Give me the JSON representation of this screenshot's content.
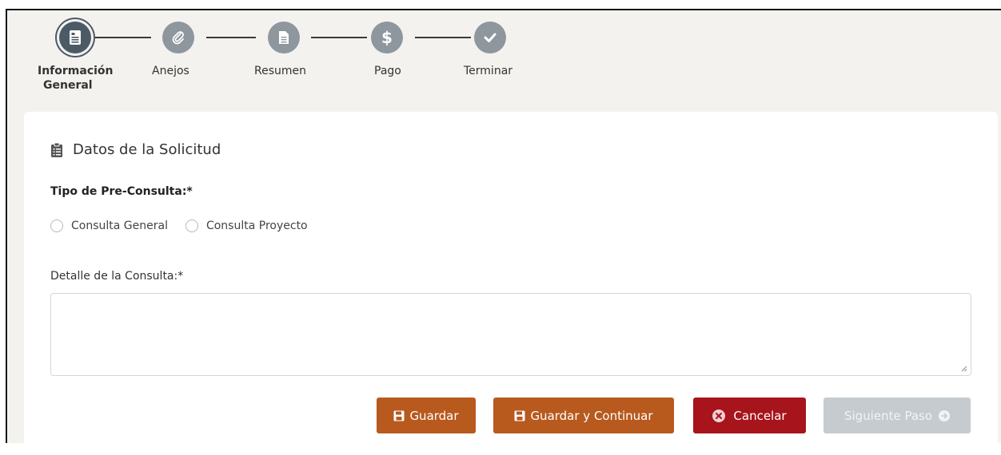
{
  "stepper": {
    "steps": [
      {
        "label_line1": "Información",
        "label_line2": "General",
        "icon": "document-icon",
        "active": true
      },
      {
        "label_line1": "Anejos",
        "label_line2": "",
        "icon": "paperclip-icon",
        "active": false
      },
      {
        "label_line1": "Resumen",
        "label_line2": "",
        "icon": "file-text-icon",
        "active": false
      },
      {
        "label_line1": "Pago",
        "label_line2": "",
        "icon": "dollar-icon",
        "active": false
      },
      {
        "label_line1": "Terminar",
        "label_line2": "",
        "icon": "checkmark-icon",
        "active": false
      }
    ]
  },
  "form": {
    "section_title": "Datos de la Solicitud",
    "tipo_label": "Tipo de Pre-Consulta:*",
    "radio_options": [
      "Consulta General",
      "Consulta Proyecto"
    ],
    "detalle_label": "Detalle de la Consulta:*",
    "detalle_value": ""
  },
  "buttons": {
    "save": "Guardar",
    "save_continue": "Guardar y Continuar",
    "cancel": "Cancelar",
    "next": "Siguiente Paso"
  },
  "colors": {
    "accent_orange": "#b8591e",
    "cancel_red": "#a8141b",
    "disabled_gray": "#c5cbcf",
    "step_active": "#4c5a65",
    "step_inactive": "#8e979d"
  }
}
